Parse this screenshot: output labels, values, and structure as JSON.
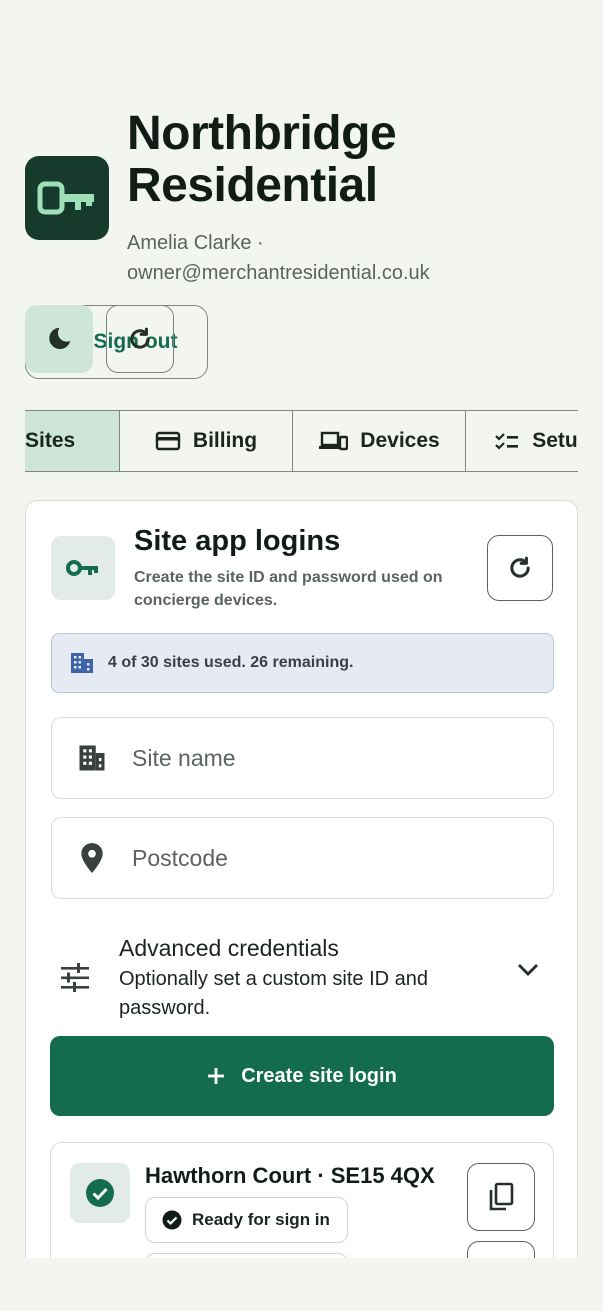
{
  "header": {
    "title": "Northbridge Residential",
    "subtitle": "Amelia Clarke · owner@merchantresidential.co.uk"
  },
  "toolbar": {
    "theme_icon": "moon-icon",
    "refresh_icon": "refresh-icon",
    "signout_label": "Sign out"
  },
  "tabs": [
    {
      "label": "Sites",
      "icon": "none",
      "active": true
    },
    {
      "label": "Billing",
      "icon": "credit-card-icon",
      "active": false
    },
    {
      "label": "Devices",
      "icon": "devices-icon",
      "active": false
    },
    {
      "label": "Setu",
      "icon": "checklist-icon",
      "active": false
    }
  ],
  "card": {
    "title": "Site app logins",
    "description": "Create the site ID and password used on concierge devices.",
    "usage": "4 of 30 sites used. 26 remaining.",
    "site_name_placeholder": "Site name",
    "postcode_placeholder": "Postcode",
    "advanced_title": "Advanced credentials",
    "advanced_desc": "Optionally set a custom site ID and password.",
    "create_label": "Create site login"
  },
  "sites": [
    {
      "name": "Hawthorn Court · SE15 4QX",
      "status": "Ready for sign in"
    }
  ],
  "colors": {
    "accent": "#146c4f",
    "logo_bg": "#163a2c",
    "active_tab": "#cde6d8",
    "banner_bg": "#e6ebf3"
  }
}
